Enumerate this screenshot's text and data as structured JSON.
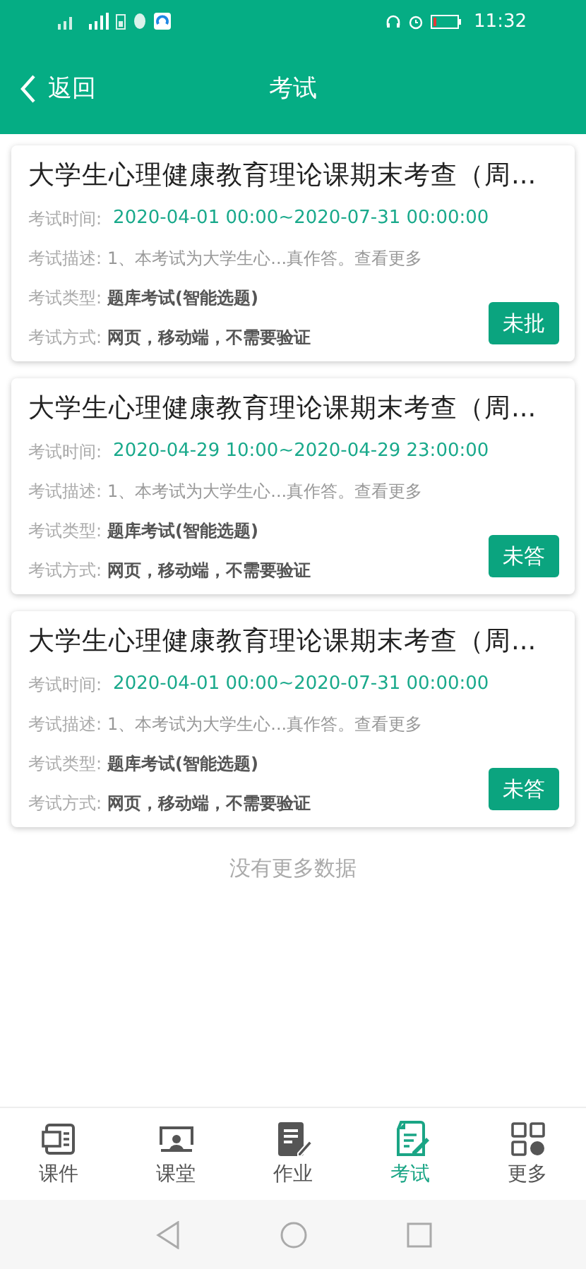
{
  "status_bar": {
    "time": "11:32"
  },
  "header": {
    "back": "返回",
    "title": "考试"
  },
  "exams": [
    {
      "title": "大学生心理健康教育理论课期末考查（周...",
      "fields": [
        {
          "label": "考试时间:",
          "value": "2020-04-01 00:00~2020-07-31 00:00:00",
          "kind": "time"
        },
        {
          "label": "考试描述:",
          "value": "1、本考试为大学生心...真作答。查看更多",
          "kind": "desc"
        },
        {
          "label": "考试类型:",
          "value": "题库考试(智能选题)",
          "kind": "bold"
        },
        {
          "label": "考试方式:",
          "value": "网页，移动端，不需要验证",
          "kind": "bold"
        }
      ],
      "status": "未批"
    },
    {
      "title": "大学生心理健康教育理论课期末考查（周...",
      "fields": [
        {
          "label": "考试时间:",
          "value": "2020-04-29 10:00~2020-04-29 23:00:00",
          "kind": "time"
        },
        {
          "label": "考试描述:",
          "value": "1、本考试为大学生心...真作答。查看更多",
          "kind": "desc"
        },
        {
          "label": "考试类型:",
          "value": "题库考试(智能选题)",
          "kind": "bold"
        },
        {
          "label": "考试方式:",
          "value": "网页，移动端，不需要验证",
          "kind": "bold"
        }
      ],
      "status": "未答"
    },
    {
      "title": "大学生心理健康教育理论课期末考查（周...",
      "fields": [
        {
          "label": "考试时间:",
          "value": "2020-04-01 00:00~2020-07-31 00:00:00",
          "kind": "time"
        },
        {
          "label": "考试描述:",
          "value": "1、本考试为大学生心...真作答。查看更多",
          "kind": "desc"
        },
        {
          "label": "考试类型:",
          "value": "题库考试(智能选题)",
          "kind": "bold"
        },
        {
          "label": "考试方式:",
          "value": "网页，移动端，不需要验证",
          "kind": "bold"
        }
      ],
      "status": "未答"
    }
  ],
  "footer_note": "没有更多数据",
  "tabs": [
    {
      "label": "课件",
      "selected": false
    },
    {
      "label": "课堂",
      "selected": false
    },
    {
      "label": "作业",
      "selected": false
    },
    {
      "label": "考试",
      "selected": true
    },
    {
      "label": "更多",
      "selected": false
    }
  ]
}
